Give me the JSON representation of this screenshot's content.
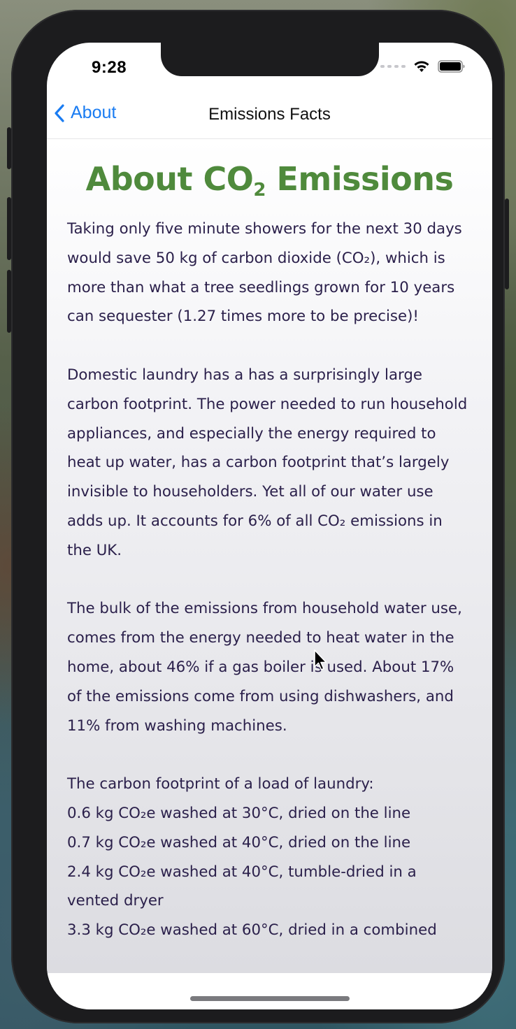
{
  "status_bar": {
    "time": "9:28",
    "icons": [
      "cellular-signal-icon",
      "wifi-icon",
      "battery-icon"
    ]
  },
  "nav": {
    "back_label": "About",
    "title": "Emissions Facts"
  },
  "content": {
    "heading_prefix": "About CO",
    "heading_sub": "2",
    "heading_suffix": " Emissions",
    "heading_color": "#4f8a3c",
    "paragraphs": [
      "Taking only five minute showers for the next 30 days would save 50 kg of carbon dioxide (CO₂), which is more than what a tree seedlings grown for 10 years can sequester (1.27 times more to be precise)!",
      "Domestic laundry has a has a surprisingly large carbon footprint. The power needed to run household appliances, and especially the energy required to heat up water, has a carbon footprint that’s largely invisible to householders. Yet all of our water use adds up. It accounts for 6% of all CO₂ emissions in the UK.",
      "The bulk of the emissions from household water use, comes from the energy needed to heat water in the home, about 46% if a gas boiler is used. About 17% of the emissions come from using dishwashers, and 11% from washing machines.",
      " The carbon footprint of a load of laundry:\n 0.6 kg CO₂e washed at 30°C, dried on the line\n 0.7 kg CO₂e washed at 40°C, dried on the line\n 2.4 kg CO₂e washed at 40°C, tumble-dried in a vented dryer\n 3.3 kg CO₂e washed at 60°C, dried in a combined"
    ]
  },
  "colors": {
    "link_blue": "#1a7cf2",
    "body_text": "#2a1f4a"
  }
}
